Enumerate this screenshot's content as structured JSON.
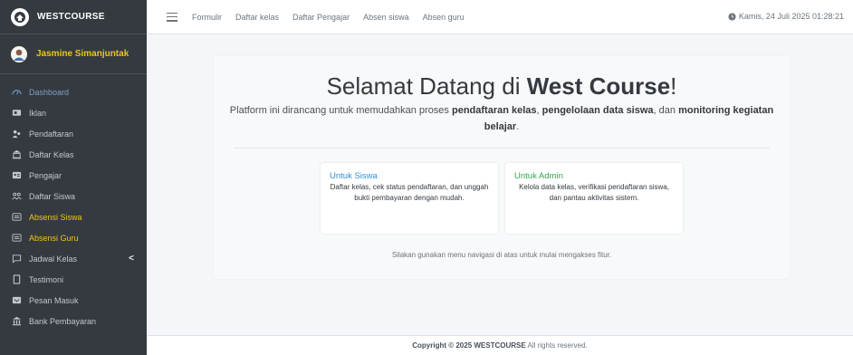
{
  "brand": {
    "name": "WESTCOURSE"
  },
  "user": {
    "name": "Jasmine Simanjuntak"
  },
  "sidebar": {
    "items": [
      {
        "label": "Dashboard",
        "icon": "dashboard-icon"
      },
      {
        "label": "Iklan",
        "icon": "ad-icon"
      },
      {
        "label": "Pendaftaran",
        "icon": "users-icon"
      },
      {
        "label": "Daftar Kelas",
        "icon": "building-icon"
      },
      {
        "label": "Pengajar",
        "icon": "id-card-icon"
      },
      {
        "label": "Daftar Siswa",
        "icon": "user-group-icon"
      },
      {
        "label": "Absensi Siswa",
        "icon": "list-icon"
      },
      {
        "label": "Absensi Guru",
        "icon": "list-icon"
      },
      {
        "label": "Jadwal Kelas",
        "icon": "comment-icon"
      },
      {
        "label": "Testimoni",
        "icon": "file-icon"
      },
      {
        "label": "Pesan Masuk",
        "icon": "inbox-icon"
      },
      {
        "label": "Bank Pembayaran",
        "icon": "bank-icon"
      }
    ],
    "submenu_indicator": "<"
  },
  "topnav": {
    "links": [
      "Formulir",
      "Daftar kelas",
      "Daftar Pengajar",
      "Absen siswa",
      "Absen guru"
    ],
    "datetime": "Kamis, 24 Juli 2025 01:28:21"
  },
  "main": {
    "title_prefix": "Selamat Datang di ",
    "title_brand": "West Course",
    "title_suffix": "!",
    "subtitle": {
      "p1": "Platform ini dirancang untuk memudahkan proses ",
      "b1": "pendaftaran kelas",
      "p2": ", ",
      "b2": "pengelolaan data siswa",
      "p3": ", dan ",
      "b3": "monitoring kegiatan belajar",
      "p4": "."
    },
    "student_box": {
      "title": "Untuk Siswa",
      "text": "Daftar kelas, cek status pendaftaran, dan unggah bukti pembayaran dengan mudah."
    },
    "admin_box": {
      "title": "Untuk Admin",
      "text": "Kelola data kelas, verifikasi pendaftaran siswa, dan pantau aktivitas sistem."
    },
    "hint": "Silakan gunakan menu navigasi di atas untuk mulai mengakses fitur."
  },
  "footer": {
    "prefix": "Copyright © 2025 ",
    "brand": "WESTCOURSE",
    "suffix": " All rights reserved."
  },
  "colors": {
    "sidebar_bg": "#343a40",
    "accent_yellow": "#f0c419",
    "student_title": "#2f8fd8",
    "admin_title": "#2fa84f"
  }
}
